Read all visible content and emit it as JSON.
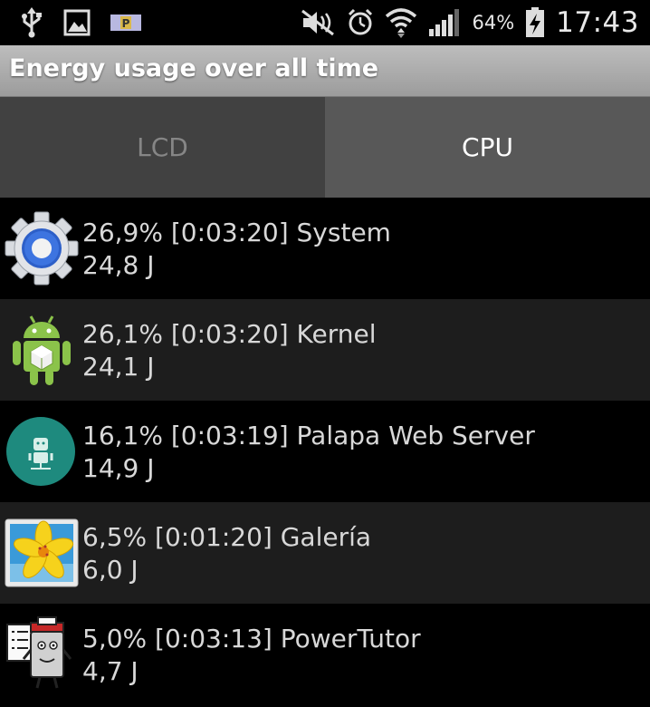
{
  "status_bar": {
    "left_icons": [
      "usb-icon",
      "image-icon",
      "parking-icon"
    ],
    "right_icons": [
      "mute-icon",
      "alarm-icon",
      "wifi-icon",
      "signal-icon",
      "battery-charging-icon"
    ],
    "battery_percent": "64%",
    "time": "17:43"
  },
  "title": "Energy usage over all time",
  "tabs": [
    {
      "label": "LCD",
      "selected": false
    },
    {
      "label": "CPU",
      "selected": true
    }
  ],
  "entries": [
    {
      "label": "26,9% [0:03:20] System",
      "energy": "24,8 J",
      "icon": "system-gear-icon"
    },
    {
      "label": "26,1% [0:03:20] Kernel",
      "energy": "24,1 J",
      "icon": "android-icon"
    },
    {
      "label": "16,1% [0:03:19] Palapa Web Server",
      "energy": "14,9 J",
      "icon": "web-server-icon"
    },
    {
      "label": "6,5% [0:01:20] Galería",
      "energy": "6,0 J",
      "icon": "gallery-icon"
    },
    {
      "label": "5,0% [0:03:13] PowerTutor",
      "energy": "4,7 J",
      "icon": "powertutor-icon"
    }
  ],
  "colors": {
    "background": "#000000",
    "row_alt": "#1d1d1d",
    "tab_selected": "#585858",
    "tab_unselected": "#414141",
    "titlebar": "#a8a8a8"
  }
}
